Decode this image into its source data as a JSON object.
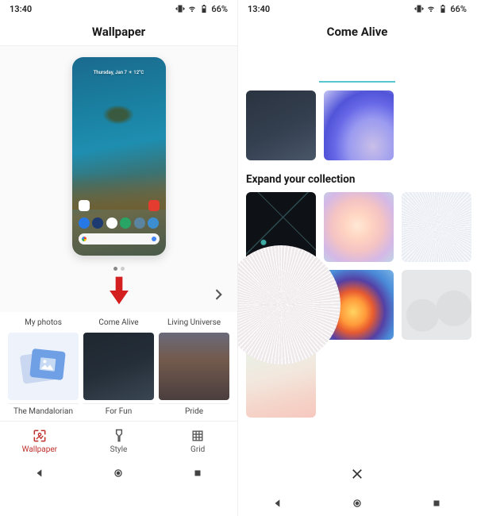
{
  "status": {
    "time": "13:40",
    "battery": "66%"
  },
  "left": {
    "header_title": "Wallpaper",
    "phone_date": "Thursday, Jan 7  ☀ 12°C",
    "collections_row1": [
      {
        "label": "My photos"
      },
      {
        "label": "Come Alive"
      },
      {
        "label": "Living Universe"
      }
    ],
    "collections_row2": [
      {
        "label": "The Mandalorian"
      },
      {
        "label": "For Fun"
      },
      {
        "label": "Pride"
      }
    ],
    "tabs": [
      {
        "label": "Wallpaper"
      },
      {
        "label": "Style"
      },
      {
        "label": "Grid"
      }
    ]
  },
  "right": {
    "header_title": "Come Alive",
    "section_heading": "Expand your collection"
  }
}
